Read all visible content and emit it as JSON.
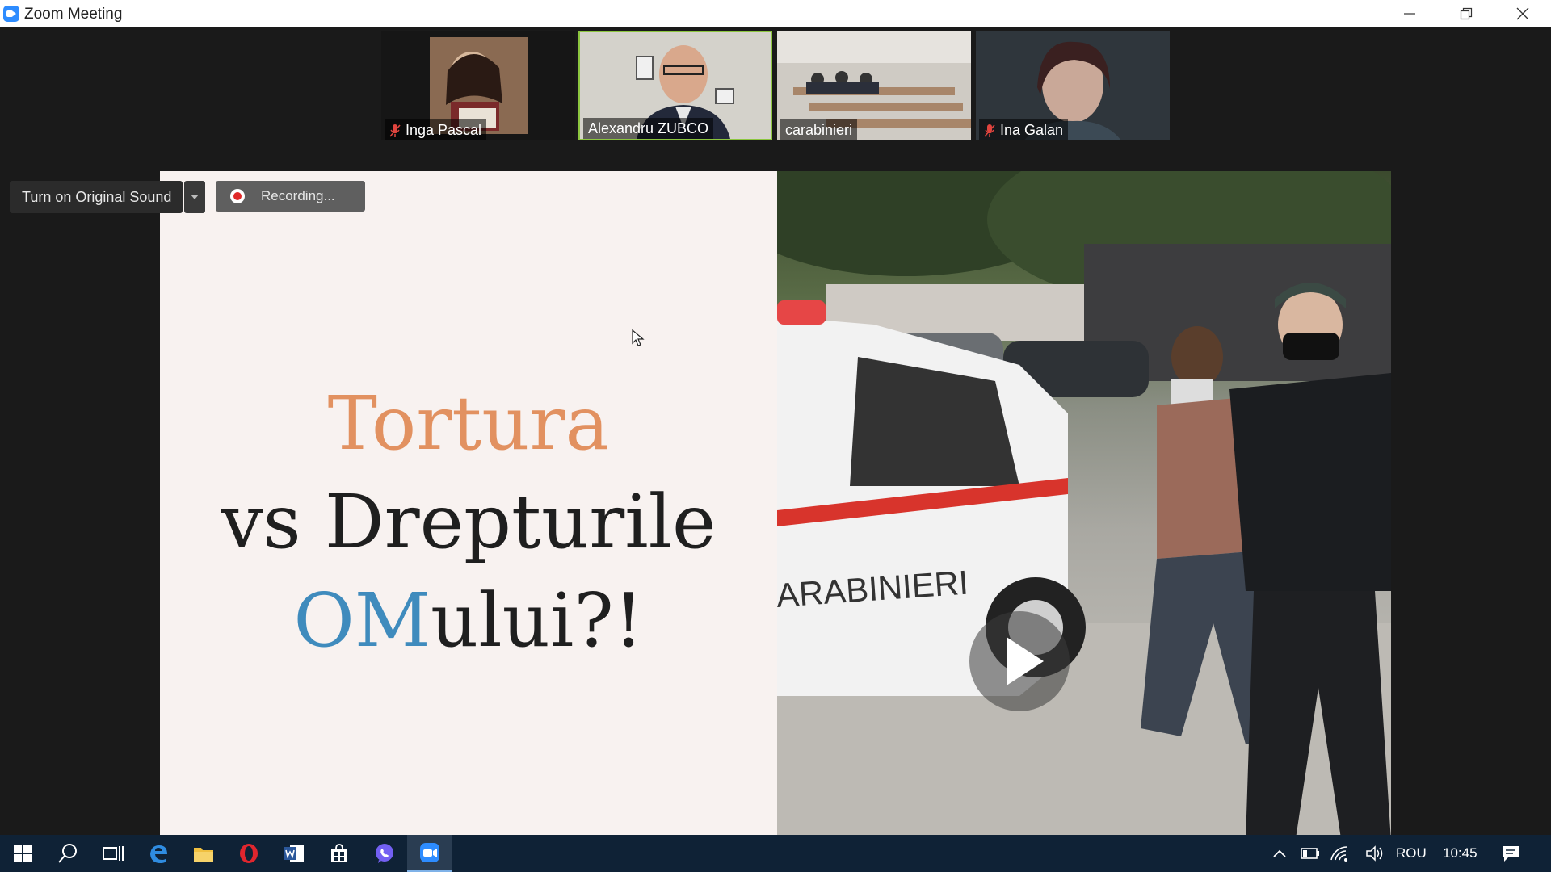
{
  "window": {
    "title": "Zoom Meeting"
  },
  "participants": [
    {
      "name": "Inga Pascal",
      "muted": true
    },
    {
      "name": "Alexandru ZUBCO",
      "muted": false,
      "active_speaker": true
    },
    {
      "name": "carabinieri",
      "muted": false
    },
    {
      "name": "Ina Galan",
      "muted": true
    }
  ],
  "controls": {
    "original_sound_label": "Turn on Original Sound",
    "recording_label": "Recording..."
  },
  "slide": {
    "line1": "Tortura",
    "line2": "vs Drepturile",
    "line3_highlight": "OM",
    "line3_rest": "ului?!"
  },
  "video": {
    "car_text": "ARABINIERI"
  },
  "taskbar": {
    "language": "ROU",
    "clock": "10:45"
  },
  "colors": {
    "accent_orange": "#e29160",
    "accent_blue": "#3f8bbd",
    "active_speaker_border": "#8cc63f",
    "recording_dot": "#e02828",
    "taskbar": "#0f2236"
  }
}
